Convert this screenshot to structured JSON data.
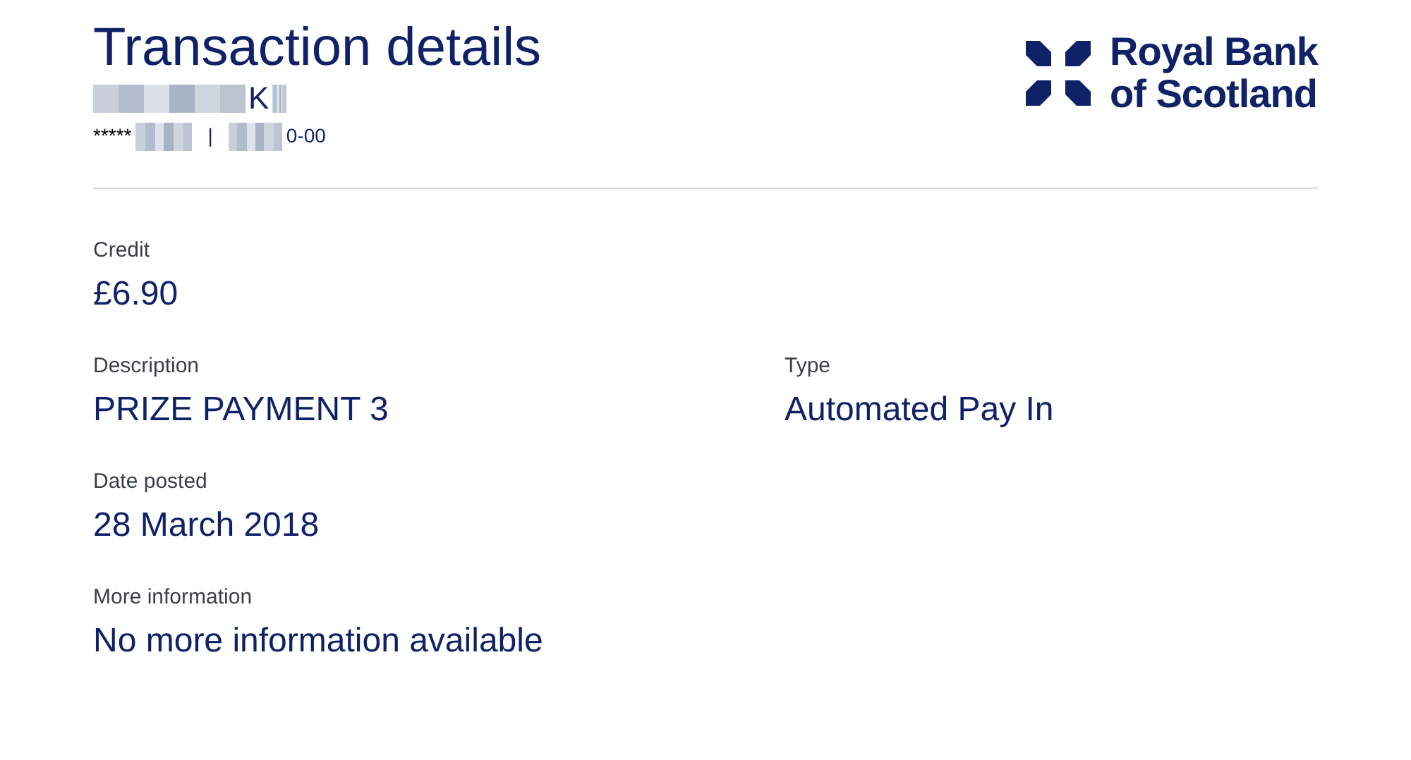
{
  "header": {
    "title": "Transaction details",
    "account_name_suffix": "K",
    "account_number_prefix": "*****",
    "separator": "|",
    "sort_code_suffix": "0-00"
  },
  "logo": {
    "line_1": "Royal Bank",
    "line_2": "of Scotland"
  },
  "detail_rows": [
    [
      {
        "label": "Credit",
        "value": "£6.90"
      }
    ],
    [
      {
        "label": "Description",
        "value": "PRIZE PAYMENT 3"
      },
      {
        "label": "Type",
        "value": "Automated Pay In"
      }
    ],
    [
      {
        "label": "Date posted",
        "value": "28 March 2018"
      }
    ],
    [
      {
        "label": "More information",
        "value": "No more information available"
      }
    ]
  ]
}
